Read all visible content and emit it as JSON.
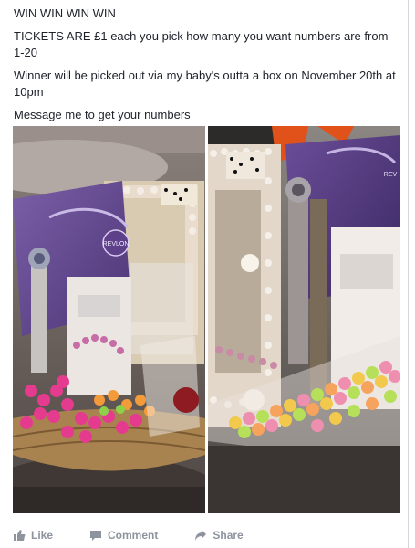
{
  "post": {
    "lines": [
      "WIN WIN WIN WIN",
      "TICKETS ARE £1 each you pick how many you want numbers are from 1-20",
      "Winner will be picked out via my baby's outta a box on November 20th at 10pm",
      "Message me to get your numbers"
    ],
    "photo_left_label": "REVLON",
    "photo_right_label": "REV"
  },
  "actions": {
    "like_label": "Like",
    "comment_label": "Comment",
    "share_label": "Share"
  },
  "colors": {
    "text": "#1d2129",
    "action_gray": "#8d949e",
    "divider": "#d3d6db"
  }
}
